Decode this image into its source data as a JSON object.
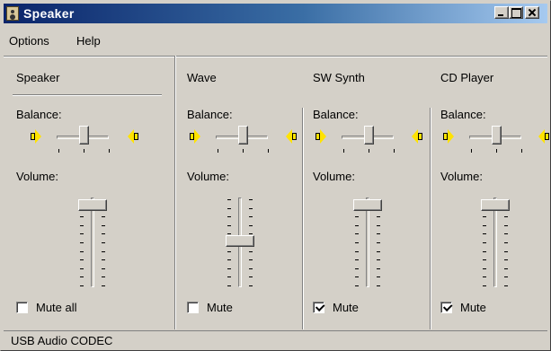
{
  "window": {
    "title": "Speaker"
  },
  "menu": {
    "items": [
      "Options",
      "Help"
    ]
  },
  "labels": {
    "balance": "Balance:",
    "volume": "Volume:"
  },
  "channels": [
    {
      "name": "Speaker",
      "mute_label": "Mute all",
      "muted": false,
      "volume_level": 0.92,
      "balance": 0.5
    },
    {
      "name": "Wave",
      "mute_label": "Mute",
      "muted": false,
      "volume_level": 0.5,
      "balance": 0.5
    },
    {
      "name": "SW Synth",
      "mute_label": "Mute",
      "muted": true,
      "volume_level": 0.92,
      "balance": 0.5
    },
    {
      "name": "CD Player",
      "mute_label": "Mute",
      "muted": true,
      "volume_level": 0.92,
      "balance": 0.5
    }
  ],
  "status": {
    "text": "USB Audio CODEC"
  },
  "colors": {
    "titlebar_start": "#0a246a",
    "titlebar_end": "#a6caf0",
    "face": "#d4d0c8",
    "speaker_icon": "#ffe300"
  }
}
